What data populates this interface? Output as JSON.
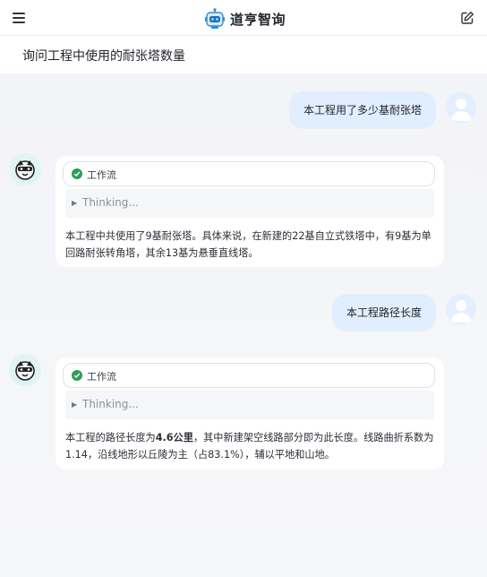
{
  "header": {
    "menu_icon": "hamburger-menu-icon",
    "logo_icon": "robot-logo-icon",
    "app_name": "道亨智询",
    "edit_icon": "new-chat-edit-icon"
  },
  "conversation": {
    "title": "询问工程中使用的耐张塔数量"
  },
  "messages": [
    {
      "role": "user",
      "text": "本工程用了多少基耐张塔"
    },
    {
      "role": "assistant",
      "workflow_label": "工作流",
      "thinking_label": "Thinking...",
      "text": "本工程中共使用了9基耐张塔。具体来说，在新建的22基自立式铁塔中，有9基为单回路耐张转角塔，其余13基为悬垂直线塔。"
    },
    {
      "role": "user",
      "text": "本工程路径长度"
    },
    {
      "role": "assistant",
      "workflow_label": "工作流",
      "thinking_label": "Thinking...",
      "text_before": "本工程的路径长度为",
      "text_bold": "4.6公里",
      "text_after": "，其中新建架空线路部分即为此长度。线路曲折系数为1.14，沿线地形以丘陵为主（占83.1%），辅以平地和山地。"
    }
  ],
  "colors": {
    "user_bubble": "#e1eefe",
    "workflow_check": "#2f9d58",
    "page_background": "#f4f5f8"
  }
}
